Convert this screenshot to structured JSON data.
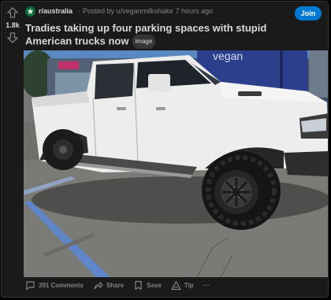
{
  "post": {
    "score": "1.8k",
    "subreddit": "r/australia",
    "posted_by": "Posted by u/veganmilkshake",
    "time": "7 hours ago",
    "join_label": "Join",
    "title": "Tradies taking up four parking spaces with stupid American trucks now",
    "flair": "image",
    "image_sign_text": "vegan"
  },
  "actions": {
    "comments": "391 Comments",
    "share": "Share",
    "save": "Save",
    "tip": "Tip",
    "more": "···"
  },
  "colors": {
    "join": "#0079d3",
    "background": "#1a1a1b",
    "text": "#d7dadc",
    "muted": "#818384"
  }
}
